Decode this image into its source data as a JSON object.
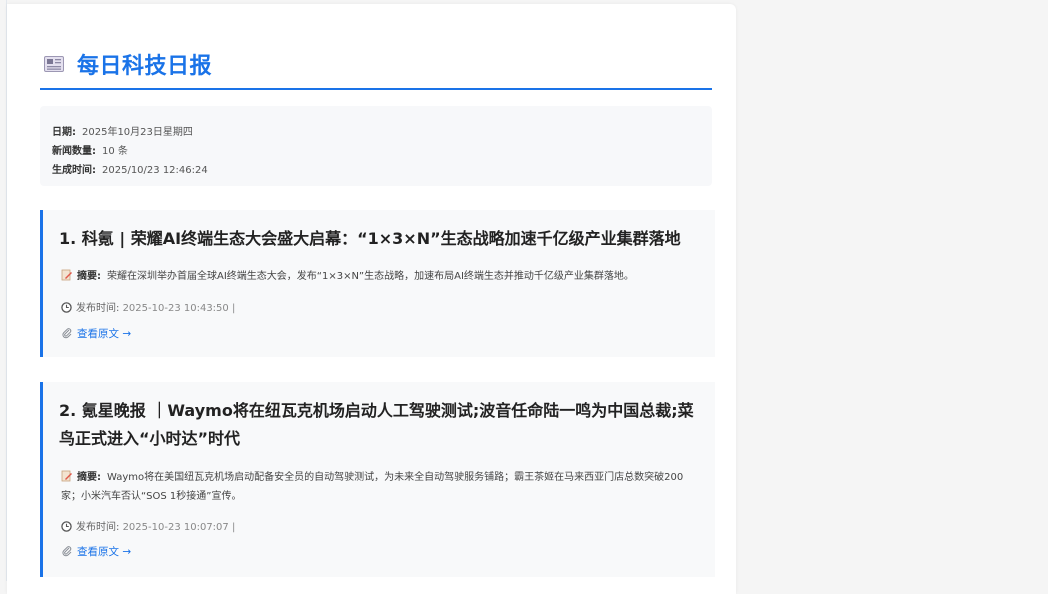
{
  "report": {
    "title": "每日科技日报"
  },
  "meta": {
    "date_label": "日期:",
    "date_value": "2025年10月23日星期四",
    "count_label": "新闻数量:",
    "count_value": "10 条",
    "generated_label": "生成时间:",
    "generated_value": "2025/10/23 12:46:24"
  },
  "articles": [
    {
      "title": "1. 科氪 | 荣耀AI终端生态大会盛大启幕：“1×3×N”生态战略加速千亿级产业集群落地",
      "summary_label": "摘要:",
      "summary": "荣耀在深圳举办首届全球AI终端生态大会，发布“1×3×N”生态战略，加速布局AI终端生态并推动千亿级产业集群落地。",
      "time_label": "发布时间:",
      "time_value": "2025-10-23 10:43:50 |",
      "link_label": "查看原文 →"
    },
    {
      "title": "2. 氪星晚报 ｜Waymo将在纽瓦克机场启动人工驾驶测试;波音任命陆一鸣为中国总裁;菜鸟正式进入“小时达”时代",
      "summary_label": "摘要:",
      "summary": "Waymo将在美国纽瓦克机场启动配备安全员的自动驾驶测试，为未来全自动驾驶服务铺路；霸王茶姬在马来西亚门店总数突破200家；小米汽车否认“SOS 1秒接通”宣传。",
      "time_label": "发布时间:",
      "time_value": "2025-10-23 10:07:07 |",
      "link_label": "查看原文 →"
    }
  ],
  "colors": {
    "accent": "#1a73e8",
    "card_bg": "#f8f9fa",
    "page_bg": "#f5f5f5"
  },
  "icons": {
    "title": "newspaper-icon",
    "summary": "pencil-memo-icon",
    "time": "clock-icon",
    "link": "paperclip-icon"
  }
}
